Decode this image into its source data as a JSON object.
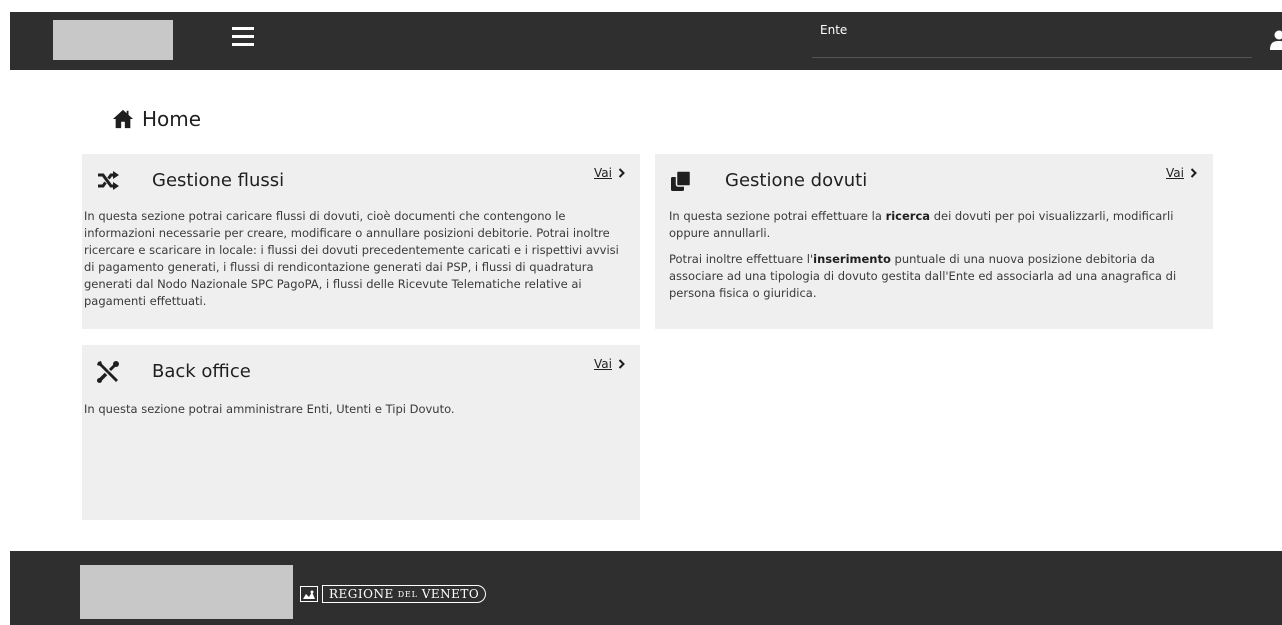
{
  "header": {
    "ente_label": "Ente",
    "menu_icon": "hamburger-icon",
    "user_icon": "user-icon"
  },
  "page": {
    "title": "Home",
    "title_icon": "home-icon"
  },
  "cards": [
    {
      "title": "Gestione flussi",
      "icon": "shuffle-icon",
      "link": "Vai",
      "paragraphs": [
        "In questa sezione potrai caricare flussi di dovuti, cioè documenti che contengono le informazioni necessarie per creare, modificare o annullare posizioni debitorie. Potrai inoltre ricercare e scaricare in locale: i flussi dei dovuti precedentemente caricati e i rispettivi avvisi di pagamento generati, i flussi di rendicontazione generati dai PSP, i flussi di quadratura generati dal Nodo Nazionale SPC PagoPA, i flussi delle Ricevute Telematiche relative ai pagamenti effettuati."
      ]
    },
    {
      "title": "Gestione dovuti",
      "icon": "clone-icon",
      "link": "Vai",
      "p1_before": "In questa sezione potrai effettuare la ",
      "p1_bold": "ricerca",
      "p1_after": " dei dovuti per poi visualizzarli, modificarli oppure annullarli.",
      "p2_before": "Potrai inoltre effettuare l'",
      "p2_bold": "inserimento",
      "p2_after": " puntuale di una nuova posizione debitoria da associare ad una tipologia di dovuto gestita dall'Ente ed associarla ad una anagrafica di persona fisica o giuridica."
    },
    {
      "title": "Back office",
      "icon": "tools-icon",
      "link": "Vai",
      "paragraphs": [
        "In questa sezione potrai amministrare Enti, Utenti e Tipi Dovuto."
      ]
    }
  ],
  "footer": {
    "regione_1": "REGIONE",
    "regione_2": "DEL",
    "regione_3": "VENETO"
  },
  "colors": {
    "header_bg": "#2f2f2f",
    "card_bg": "#efefef",
    "placeholder": "#c8c8c8"
  }
}
